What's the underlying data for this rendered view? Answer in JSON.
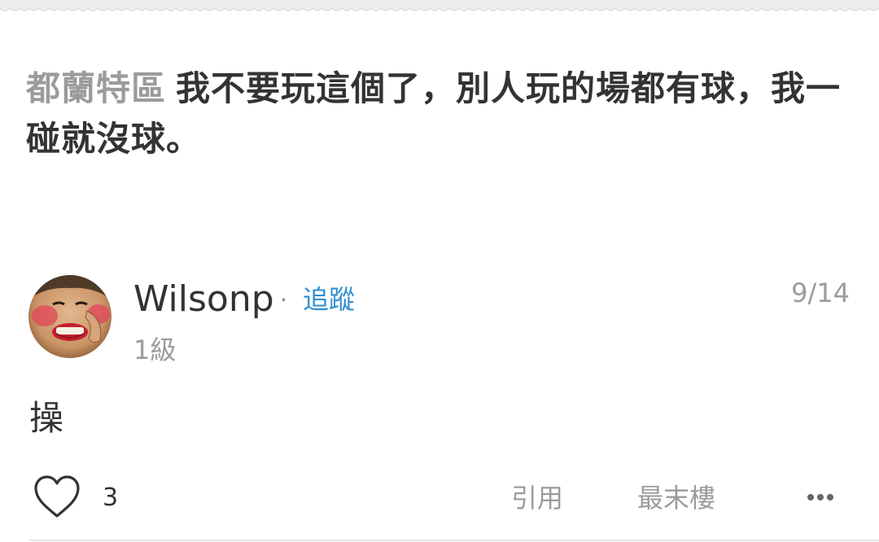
{
  "post": {
    "board_name": "都蘭特區",
    "title": "我不要玩這個了，別人玩的場都有球，我一碰就沒球。"
  },
  "reply": {
    "username": "Wilsonp",
    "separator": "·",
    "follow_label": "追蹤",
    "level": "1級",
    "date": "9/14",
    "content": "操",
    "like_count": "3",
    "quote_label": "引用",
    "last_floor_label": "最末樓"
  },
  "icons": {
    "like": "heart-outline-icon",
    "more": "more-dots-icon"
  },
  "colors": {
    "accent": "#2f8fd1",
    "text": "#333333",
    "muted": "#9b9b9b"
  }
}
